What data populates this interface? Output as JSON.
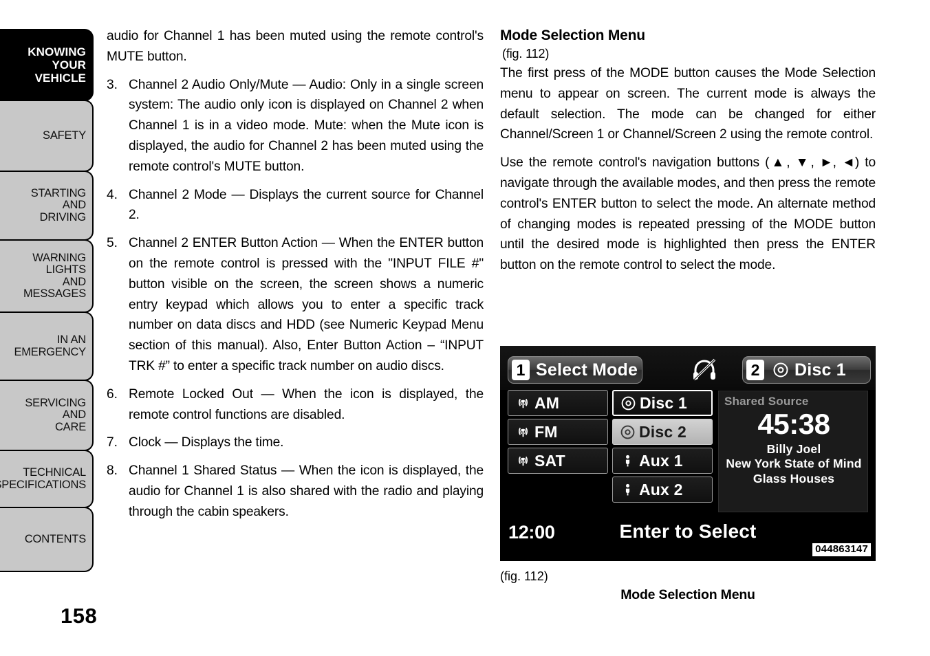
{
  "page": {
    "number": "158"
  },
  "sidebar": {
    "items": [
      {
        "label": "KNOWING\nYOUR\nVEHICLE",
        "name": "knowing-your-vehicle",
        "current": true
      },
      {
        "label": "SAFETY",
        "name": "safety",
        "current": false
      },
      {
        "label": "STARTING\nAND\nDRIVING",
        "name": "starting-and-driving",
        "current": false
      },
      {
        "label": "WARNING\nLIGHTS\nAND\nMESSAGES",
        "name": "warning-lights-and-messages",
        "current": false
      },
      {
        "label": "IN AN\nEMERGENCY",
        "name": "in-an-emergency",
        "current": false
      },
      {
        "label": "SERVICING\nAND\nCARE",
        "name": "servicing-and-care",
        "current": false
      },
      {
        "label": "TECHNICAL\nSPECIFICATIONS",
        "name": "technical-specifications",
        "current": false
      },
      {
        "label": "CONTENTS",
        "name": "contents",
        "current": false
      }
    ]
  },
  "left_column": {
    "continuation": "audio for Channel 1 has been muted using the remote control's MUTE button.",
    "items": [
      {
        "number": "3.",
        "text": "Channel 2 Audio Only/Mute — Audio: Only in a single screen system: The audio only icon is displayed on Channel 2 when Channel 1 is in a video mode. Mute: when the Mute icon is displayed, the audio for Channel 2 has been muted using the remote control's MUTE button."
      },
      {
        "number": "4.",
        "text": "Channel 2 Mode — Displays the current source for Channel 2."
      },
      {
        "number": "5.",
        "text": "Channel 2 ENTER Button Action — When the ENTER button on the remote control is pressed with the \"INPUT FILE #\" button visible on the screen, the screen shows a numeric entry keypad which allows you to enter a specific track number on data discs and HDD (see Numeric Keypad Menu section of this manual). Also, Enter Button Action – “INPUT TRK #” to enter a specific track number on audio discs."
      },
      {
        "number": "6.",
        "text": "Remote Locked Out — When the icon is displayed, the remote control functions are disabled."
      },
      {
        "number": "7.",
        "text": "Clock — Displays the time."
      },
      {
        "number": "8.",
        "text": "Channel 1 Shared Status — When the icon is displayed, the audio for Channel 1 is also shared with the radio and playing through the cabin speakers."
      }
    ]
  },
  "right_column": {
    "heading": "Mode Selection Menu",
    "figure_ref": "(fig. 112)",
    "paragraphs": [
      "The first press of the MODE button causes the Mode Selection menu to appear on screen. The current mode is always the default selection. The mode can be changed for either Channel/Screen 1 or Channel/Screen 2 using the remote control.",
      "Use the remote control's navigation buttons (▲, ▼, ►, ◄) to navigate through the available modes, and then press the remote control's ENTER button to select the mode. An alternate method of changing modes is repeated pressing of the MODE button until the desired mode is highlighted then press the ENTER button on the remote control to select the mode."
    ]
  },
  "figure": {
    "header": {
      "channel1_badge": "1",
      "channel1_label": "Select Mode",
      "mute_icon": "headphones-muted-icon",
      "channel2_badge": "2",
      "channel2_disc_icon": "disc-icon",
      "channel2_label": "Disc 1"
    },
    "menu_column_a": [
      {
        "icon": "antenna-icon",
        "label": "AM",
        "state": "normal"
      },
      {
        "icon": "antenna-icon",
        "label": "FM",
        "state": "normal"
      },
      {
        "icon": "antenna-icon",
        "label": "SAT",
        "state": "normal"
      }
    ],
    "menu_column_b": [
      {
        "icon": "disc-icon",
        "label": "Disc 1",
        "state": "focused"
      },
      {
        "icon": "disc-icon",
        "label": "Disc 2",
        "state": "selected"
      },
      {
        "icon": "aux-plug-icon",
        "label": "Aux 1",
        "state": "normal"
      },
      {
        "icon": "aux-plug-icon",
        "label": "Aux 2",
        "state": "normal"
      }
    ],
    "now_playing": {
      "source_label": "Shared Source",
      "elapsed_time": "45:38",
      "artist": "Billy Joel",
      "track": "New York State of Mind",
      "album": "Glass Houses"
    },
    "footer": {
      "clock": "12:00",
      "hint": "Enter to Select",
      "part_number": "044863147"
    }
  },
  "caption": {
    "figure_ref": "(fig. 112)",
    "title": "Mode Selection Menu"
  }
}
